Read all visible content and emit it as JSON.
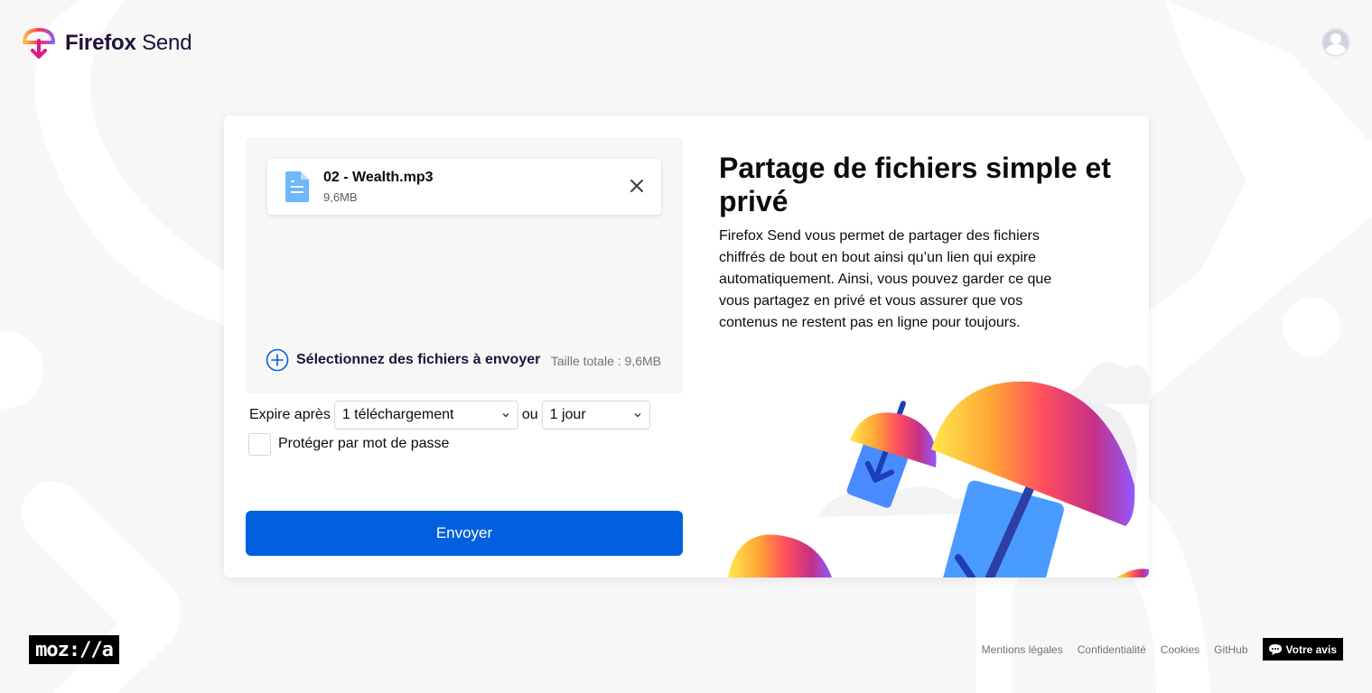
{
  "app": {
    "brand_bold": "Firefox",
    "brand_light": "Send"
  },
  "upload": {
    "files": [
      {
        "name": "02 - Wealth.mp3",
        "size": "9,6MB"
      }
    ],
    "add_label": "Sélectionnez des fichiers à envoyer",
    "total_size": "Taille totale : 9,6MB"
  },
  "options": {
    "expire_label": "Expire après",
    "downloads_value": "1 téléchargement",
    "separator": "ou",
    "time_value": "1 jour",
    "password_label": "Protéger par mot de passe",
    "password_checked": false
  },
  "send_button": "Envoyer",
  "intro": {
    "title": "Partage de fichiers simple et privé",
    "description": "Firefox Send vous permet de partager des fichiers chiffrés de bout en bout ainsi qu’un lien qui expire automatiquement. Ainsi, vous pouvez garder ce que vous partagez en privé et vous assurer que vos contenus ne restent pas en ligne pour toujours."
  },
  "footer": {
    "logo_text": "moz://a",
    "links": [
      "Mentions légales",
      "Confidentialité",
      "Cookies",
      "GitHub"
    ],
    "feedback_label": "Votre avis"
  },
  "colors": {
    "primary": "#0060df",
    "background": "#f7f7f7",
    "brand_text": "#20123a"
  },
  "icons": [
    "send-logo-icon",
    "user-avatar-icon",
    "file-icon",
    "close-icon",
    "add-circle-icon",
    "chevron-down-icon",
    "feedback-chat-icon"
  ]
}
